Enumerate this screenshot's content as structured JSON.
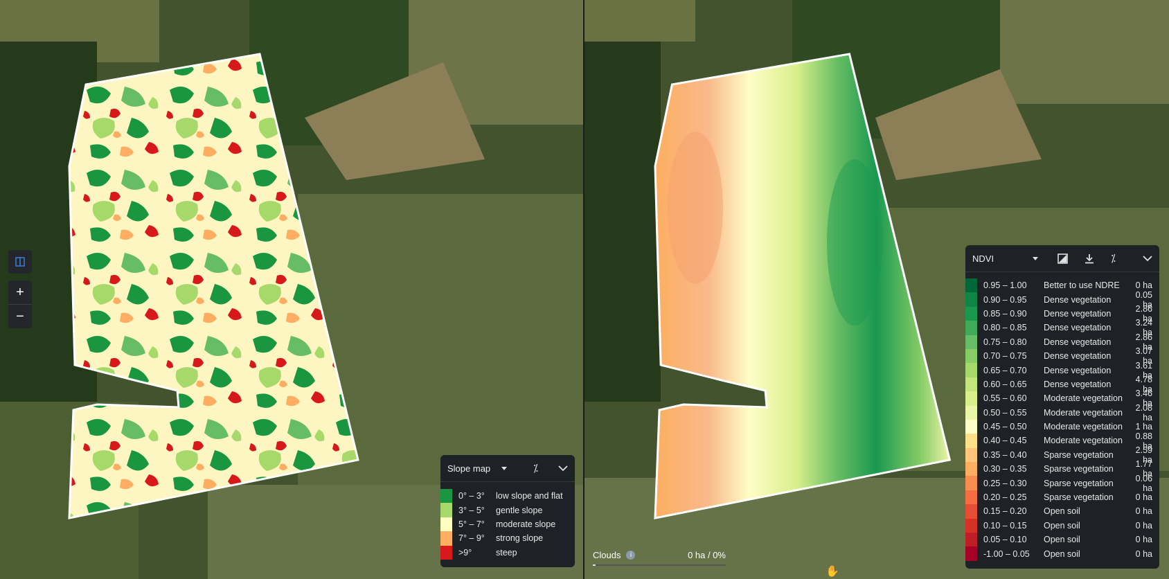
{
  "left_map": {
    "controls": {
      "compare_icon": "split-view-icon",
      "zoom_in": "+",
      "zoom_out": "−"
    },
    "legend": {
      "title": "Slope map",
      "icons": [
        "chevron-down-icon",
        "percent-icon",
        "collapse-chevron-icon"
      ],
      "rows": [
        {
          "range": "0° – 3°",
          "label": "low slope and flat",
          "color": "#1a9641"
        },
        {
          "range": "3° – 5°",
          "label": "gentle slope",
          "color": "#a6d96a"
        },
        {
          "range": "5° – 7°",
          "label": "moderate slope",
          "color": "#ffffbf"
        },
        {
          "range": "7° – 9°",
          "label": "strong slope",
          "color": "#fdae61"
        },
        {
          "range": ">9°",
          "label": "steep",
          "color": "#d7191c"
        }
      ]
    }
  },
  "right_map": {
    "legend": {
      "title": "NDVI",
      "icons": [
        "chevron-down-icon",
        "image-icon",
        "download-icon",
        "percent-icon",
        "collapse-chevron-icon"
      ],
      "rows": [
        {
          "range": "0.95 – 1.00",
          "label": "Better to use NDRE",
          "area": "0 ha",
          "color": "#006837"
        },
        {
          "range": "0.90 – 0.95",
          "label": "Dense vegetation",
          "area": "0.05 ha",
          "color": "#0f8446"
        },
        {
          "range": "0.85 – 0.90",
          "label": "Dense vegetation",
          "area": "2.86 ha",
          "color": "#1a9850"
        },
        {
          "range": "0.80 – 0.85",
          "label": "Dense vegetation",
          "area": "3.24 ha",
          "color": "#3faa59"
        },
        {
          "range": "0.75 – 0.80",
          "label": "Dense vegetation",
          "area": "2.86 ha",
          "color": "#66bd63"
        },
        {
          "range": "0.70 – 0.75",
          "label": "Dense vegetation",
          "area": "3.07 ha",
          "color": "#85cb66"
        },
        {
          "range": "0.65 – 0.70",
          "label": "Dense vegetation",
          "area": "3.61 ha",
          "color": "#a6d96a"
        },
        {
          "range": "0.60 – 0.65",
          "label": "Dense vegetation",
          "area": "4.78 ha",
          "color": "#c2e57c"
        },
        {
          "range": "0.55 – 0.60",
          "label": "Moderate vegetation",
          "area": "3.46 ha",
          "color": "#d9ef8b"
        },
        {
          "range": "0.50 – 0.55",
          "label": "Moderate vegetation",
          "area": "2.08 ha",
          "color": "#eaf5a8"
        },
        {
          "range": "0.45 – 0.50",
          "label": "Moderate vegetation",
          "area": "1 ha",
          "color": "#fffdc6"
        },
        {
          "range": "0.40 – 0.45",
          "label": "Moderate vegetation",
          "area": "0.88 ha",
          "color": "#fee08b"
        },
        {
          "range": "0.35 – 0.40",
          "label": "Sparse vegetation",
          "area": "2.59 ha",
          "color": "#fdc67a"
        },
        {
          "range": "0.30 – 0.35",
          "label": "Sparse vegetation",
          "area": "1.77 ha",
          "color": "#fdae61"
        },
        {
          "range": "0.25 – 0.30",
          "label": "Sparse vegetation",
          "area": "0.06 ha",
          "color": "#f88d52"
        },
        {
          "range": "0.20 – 0.25",
          "label": "Sparse vegetation",
          "area": "0 ha",
          "color": "#f46d43"
        },
        {
          "range": "0.15 – 0.20",
          "label": "Open soil",
          "area": "0 ha",
          "color": "#e54e35"
        },
        {
          "range": "0.10 – 0.15",
          "label": "Open soil",
          "area": "0 ha",
          "color": "#d73027"
        },
        {
          "range": "0.05 – 0.10",
          "label": "Open soil",
          "area": "0 ha",
          "color": "#c01e27"
        },
        {
          "range": "-1.00 – 0.05",
          "label": "Open soil",
          "area": "0 ha",
          "color": "#a50026"
        }
      ]
    },
    "clouds": {
      "label": "Clouds",
      "value": "0 ha / 0%",
      "info_icon": "info-icon",
      "fraction": 0
    }
  }
}
